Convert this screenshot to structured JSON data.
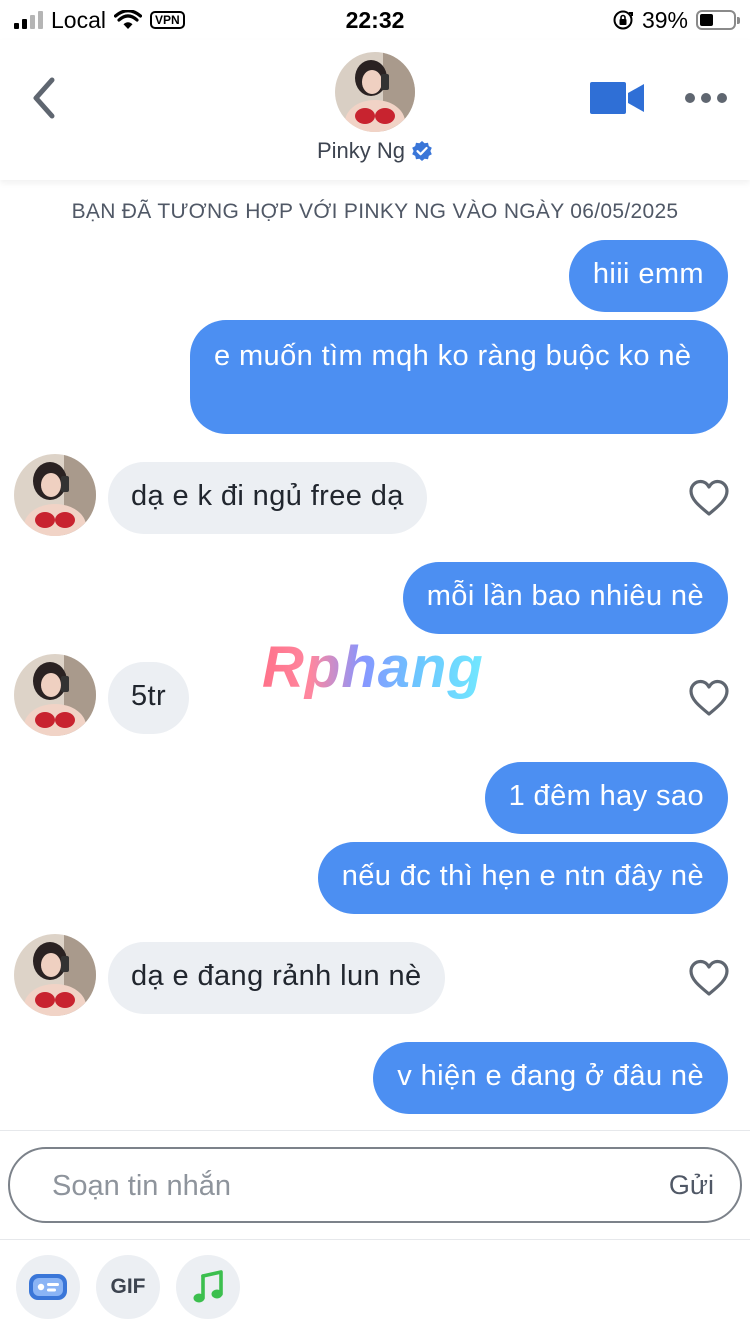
{
  "status_bar": {
    "carrier": "Local",
    "vpn": "VPN",
    "time": "22:32",
    "battery_percent": "39%"
  },
  "header": {
    "name": "Pinky Ng",
    "verified": true,
    "icons": {
      "back": "chevron-left-icon",
      "video": "video-camera-icon",
      "more": "more-dots-icon",
      "verified": "verified-badge-icon"
    },
    "accent_color": "#3a76d8"
  },
  "chat": {
    "match_note": "BẠN ĐÃ TƯƠNG HỢP VỚI PINKY NG VÀO NGÀY 06/05/2025",
    "messages": [
      {
        "from": "me",
        "text": "hiii emm"
      },
      {
        "from": "me",
        "text": "e muốn tìm mqh ko ràng buộc ko nè"
      },
      {
        "from": "them",
        "text": "dạ e k đi ngủ free dạ"
      },
      {
        "from": "me",
        "text": "mỗi lần bao nhiêu nè"
      },
      {
        "from": "them",
        "text": "5tr"
      },
      {
        "from": "me",
        "text": "1 đêm hay sao"
      },
      {
        "from": "me",
        "text": "nếu đc thì hẹn e ntn đây nè"
      },
      {
        "from": "them",
        "text": "dạ e đang rảnh lun nè"
      },
      {
        "from": "me",
        "text": "v hiện e đang ở đâu nè"
      }
    ],
    "outgoing_color": "#4c8ff2",
    "incoming_color": "#eceff3",
    "watermark": "Rphang"
  },
  "composer": {
    "placeholder": "Soạn tin nhắn",
    "send_label": "Gửi",
    "gif_label": "GIF",
    "tools": [
      "sticker-card-icon",
      "gif-icon",
      "music-note-icon"
    ]
  }
}
